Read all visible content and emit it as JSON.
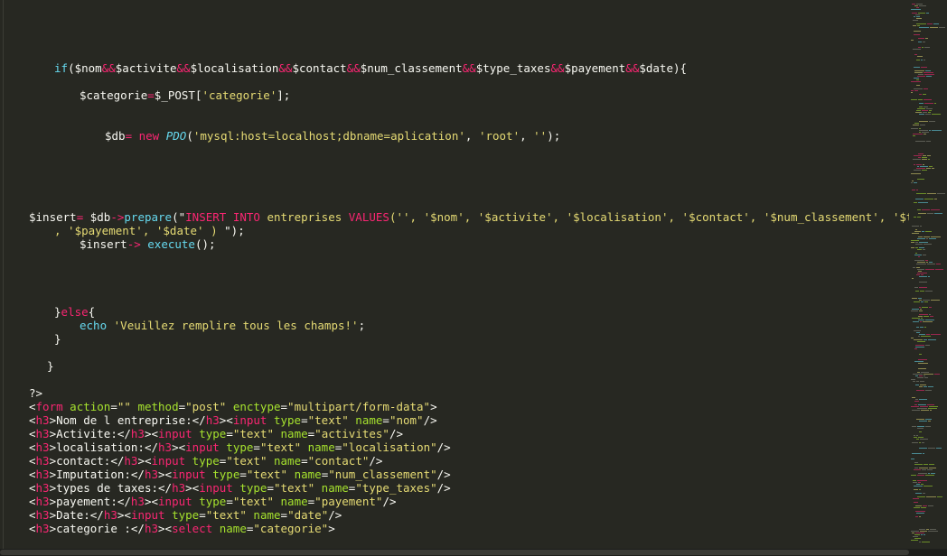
{
  "colors": {
    "background": "#272822",
    "foreground": "#f8f8f2",
    "keyword": "#f92672",
    "string": "#e6db74",
    "function": "#66d9ef",
    "attribute": "#a6e22e"
  },
  "code": {
    "l01": [
      {
        "c": "fn",
        "t": "if"
      },
      {
        "c": "fg",
        "t": "($nom"
      },
      {
        "c": "kw",
        "t": "&&"
      },
      {
        "c": "fg",
        "t": "$activite"
      },
      {
        "c": "kw",
        "t": "&&"
      },
      {
        "c": "fg",
        "t": "$localisation"
      },
      {
        "c": "kw",
        "t": "&&"
      },
      {
        "c": "fg",
        "t": "$contact"
      },
      {
        "c": "kw",
        "t": "&&"
      },
      {
        "c": "fg",
        "t": "$num_classement"
      },
      {
        "c": "kw",
        "t": "&&"
      },
      {
        "c": "fg",
        "t": "$type_taxes"
      },
      {
        "c": "kw",
        "t": "&&"
      },
      {
        "c": "fg",
        "t": "$payement"
      },
      {
        "c": "kw",
        "t": "&&"
      },
      {
        "c": "fg",
        "t": "$date){"
      }
    ],
    "l02": [
      {
        "c": "fg",
        "t": "$categorie"
      },
      {
        "c": "kw",
        "t": "="
      },
      {
        "c": "fg",
        "t": "$_POST["
      },
      {
        "c": "str",
        "t": "'categorie'"
      },
      {
        "c": "fg",
        "t": "];"
      }
    ],
    "l03": [
      {
        "c": "fg",
        "t": "$db"
      },
      {
        "c": "kw",
        "t": "= new "
      },
      {
        "c": "cls",
        "t": "PDO"
      },
      {
        "c": "fg",
        "t": "("
      },
      {
        "c": "str",
        "t": "'mysql:host=localhost;dbname=aplication'"
      },
      {
        "c": "fg",
        "t": ", "
      },
      {
        "c": "str",
        "t": "'root'"
      },
      {
        "c": "fg",
        "t": ", "
      },
      {
        "c": "str",
        "t": "''"
      },
      {
        "c": "fg",
        "t": ");"
      }
    ],
    "l04": [
      {
        "c": "fg",
        "t": "$insert"
      },
      {
        "c": "kw",
        "t": "="
      },
      {
        "c": "fg",
        "t": " $db"
      },
      {
        "c": "kw",
        "t": "->"
      },
      {
        "c": "fn",
        "t": "prepare"
      },
      {
        "c": "fg",
        "t": "(\""
      },
      {
        "c": "kw",
        "t": "INSERT INTO"
      },
      {
        "c": "str",
        "t": " entreprises "
      },
      {
        "c": "kw",
        "t": "VALUES"
      },
      {
        "c": "str",
        "t": "('', '$nom', '$activite', '$localisation', '$contact', '$num_classement', '$type_taxes'"
      }
    ],
    "l05": [
      {
        "c": "str",
        "t": ", '$payement', '$date' ) "
      },
      {
        "c": "fg",
        "t": "\");"
      }
    ],
    "l06": [
      {
        "c": "fg",
        "t": "$insert"
      },
      {
        "c": "kw",
        "t": "-> "
      },
      {
        "c": "fn",
        "t": "execute"
      },
      {
        "c": "fg",
        "t": "();"
      }
    ],
    "l07": [
      {
        "c": "fg",
        "t": "}"
      },
      {
        "c": "kw",
        "t": "else"
      },
      {
        "c": "fg",
        "t": "{"
      }
    ],
    "l08": [
      {
        "c": "fn",
        "t": "echo "
      },
      {
        "c": "str",
        "t": "'Veuillez remplire tous les champs!'"
      },
      {
        "c": "fg",
        "t": ";"
      }
    ],
    "l09": [
      {
        "c": "fg",
        "t": "}"
      }
    ],
    "l10": [
      {
        "c": "fg",
        "t": "}"
      }
    ],
    "l11": [
      {
        "c": "fg",
        "t": "?>"
      }
    ],
    "l12": [
      {
        "c": "fg",
        "t": "<"
      },
      {
        "c": "kw",
        "t": "form"
      },
      {
        "c": "attr",
        "t": " action"
      },
      {
        "c": "fg",
        "t": "="
      },
      {
        "c": "str",
        "t": "\"\""
      },
      {
        "c": "attr",
        "t": " method"
      },
      {
        "c": "fg",
        "t": "="
      },
      {
        "c": "str",
        "t": "\"post\""
      },
      {
        "c": "attr",
        "t": " enctype"
      },
      {
        "c": "fg",
        "t": "="
      },
      {
        "c": "str",
        "t": "\"multipart/form-data\""
      },
      {
        "c": "fg",
        "t": ">"
      }
    ],
    "l13": [
      {
        "c": "fg",
        "t": "<"
      },
      {
        "c": "kw",
        "t": "h3"
      },
      {
        "c": "fg",
        "t": ">Nom de l entreprise:</"
      },
      {
        "c": "kw",
        "t": "h3"
      },
      {
        "c": "fg",
        "t": "><"
      },
      {
        "c": "kw",
        "t": "input"
      },
      {
        "c": "attr",
        "t": " type"
      },
      {
        "c": "fg",
        "t": "="
      },
      {
        "c": "str",
        "t": "\"text\""
      },
      {
        "c": "attr",
        "t": " name"
      },
      {
        "c": "fg",
        "t": "="
      },
      {
        "c": "str",
        "t": "\"nom\""
      },
      {
        "c": "fg",
        "t": "/>"
      }
    ],
    "l14": [
      {
        "c": "fg",
        "t": "<"
      },
      {
        "c": "kw",
        "t": "h3"
      },
      {
        "c": "fg",
        "t": ">Activite:</"
      },
      {
        "c": "kw",
        "t": "h3"
      },
      {
        "c": "fg",
        "t": "><"
      },
      {
        "c": "kw",
        "t": "input"
      },
      {
        "c": "attr",
        "t": " type"
      },
      {
        "c": "fg",
        "t": "="
      },
      {
        "c": "str",
        "t": "\"text\""
      },
      {
        "c": "attr",
        "t": " name"
      },
      {
        "c": "fg",
        "t": "="
      },
      {
        "c": "str",
        "t": "\"activites\""
      },
      {
        "c": "fg",
        "t": "/>"
      }
    ],
    "l15": [
      {
        "c": "fg",
        "t": "<"
      },
      {
        "c": "kw",
        "t": "h3"
      },
      {
        "c": "fg",
        "t": ">localisation:</"
      },
      {
        "c": "kw",
        "t": "h3"
      },
      {
        "c": "fg",
        "t": "><"
      },
      {
        "c": "kw",
        "t": "input"
      },
      {
        "c": "attr",
        "t": " type"
      },
      {
        "c": "fg",
        "t": "="
      },
      {
        "c": "str",
        "t": "\"text\""
      },
      {
        "c": "attr",
        "t": " name"
      },
      {
        "c": "fg",
        "t": "="
      },
      {
        "c": "str",
        "t": "\"localisation\""
      },
      {
        "c": "fg",
        "t": "/>"
      }
    ],
    "l16": [
      {
        "c": "fg",
        "t": "<"
      },
      {
        "c": "kw",
        "t": "h3"
      },
      {
        "c": "fg",
        "t": ">contact:</"
      },
      {
        "c": "kw",
        "t": "h3"
      },
      {
        "c": "fg",
        "t": "><"
      },
      {
        "c": "kw",
        "t": "input"
      },
      {
        "c": "attr",
        "t": " type"
      },
      {
        "c": "fg",
        "t": "="
      },
      {
        "c": "str",
        "t": "\"text\""
      },
      {
        "c": "attr",
        "t": " name"
      },
      {
        "c": "fg",
        "t": "="
      },
      {
        "c": "str",
        "t": "\"contact\""
      },
      {
        "c": "fg",
        "t": "/>"
      }
    ],
    "l17": [
      {
        "c": "fg",
        "t": "<"
      },
      {
        "c": "kw",
        "t": "h3"
      },
      {
        "c": "fg",
        "t": ">Imputation:</"
      },
      {
        "c": "kw",
        "t": "h3"
      },
      {
        "c": "fg",
        "t": "><"
      },
      {
        "c": "kw",
        "t": "input"
      },
      {
        "c": "attr",
        "t": " type"
      },
      {
        "c": "fg",
        "t": "="
      },
      {
        "c": "str",
        "t": "\"text\""
      },
      {
        "c": "attr",
        "t": " name"
      },
      {
        "c": "fg",
        "t": "="
      },
      {
        "c": "str",
        "t": "\"num_classement\""
      },
      {
        "c": "fg",
        "t": "/>"
      }
    ],
    "l18": [
      {
        "c": "fg",
        "t": "<"
      },
      {
        "c": "kw",
        "t": "h3"
      },
      {
        "c": "fg",
        "t": ">types de taxes:</"
      },
      {
        "c": "kw",
        "t": "h3"
      },
      {
        "c": "fg",
        "t": "><"
      },
      {
        "c": "kw",
        "t": "input"
      },
      {
        "c": "attr",
        "t": " type"
      },
      {
        "c": "fg",
        "t": "="
      },
      {
        "c": "str",
        "t": "\"text\""
      },
      {
        "c": "attr",
        "t": " name"
      },
      {
        "c": "fg",
        "t": "="
      },
      {
        "c": "str",
        "t": "\"type_taxes\""
      },
      {
        "c": "fg",
        "t": "/>"
      }
    ],
    "l19": [
      {
        "c": "fg",
        "t": "<"
      },
      {
        "c": "kw",
        "t": "h3"
      },
      {
        "c": "fg",
        "t": ">payement:</"
      },
      {
        "c": "kw",
        "t": "h3"
      },
      {
        "c": "fg",
        "t": "><"
      },
      {
        "c": "kw",
        "t": "input"
      },
      {
        "c": "attr",
        "t": " type"
      },
      {
        "c": "fg",
        "t": "="
      },
      {
        "c": "str",
        "t": "\"text\""
      },
      {
        "c": "attr",
        "t": " name"
      },
      {
        "c": "fg",
        "t": "="
      },
      {
        "c": "str",
        "t": "\"payement\""
      },
      {
        "c": "fg",
        "t": "/>"
      }
    ],
    "l20": [
      {
        "c": "fg",
        "t": "<"
      },
      {
        "c": "kw",
        "t": "h3"
      },
      {
        "c": "fg",
        "t": ">Date:</"
      },
      {
        "c": "kw",
        "t": "h3"
      },
      {
        "c": "fg",
        "t": "><"
      },
      {
        "c": "kw",
        "t": "input"
      },
      {
        "c": "attr",
        "t": " type"
      },
      {
        "c": "fg",
        "t": "="
      },
      {
        "c": "str",
        "t": "\"text\""
      },
      {
        "c": "attr",
        "t": " name"
      },
      {
        "c": "fg",
        "t": "="
      },
      {
        "c": "str",
        "t": "\"date\""
      },
      {
        "c": "fg",
        "t": "/>"
      }
    ],
    "l21": [
      {
        "c": "fg",
        "t": "<"
      },
      {
        "c": "kw",
        "t": "h3"
      },
      {
        "c": "fg",
        "t": ">categorie :</"
      },
      {
        "c": "kw",
        "t": "h3"
      },
      {
        "c": "fg",
        "t": "><"
      },
      {
        "c": "kw",
        "t": "select"
      },
      {
        "c": "attr",
        "t": " name"
      },
      {
        "c": "fg",
        "t": "="
      },
      {
        "c": "str",
        "t": "\"categorie\""
      },
      {
        "c": "fg",
        "t": ">"
      }
    ]
  }
}
